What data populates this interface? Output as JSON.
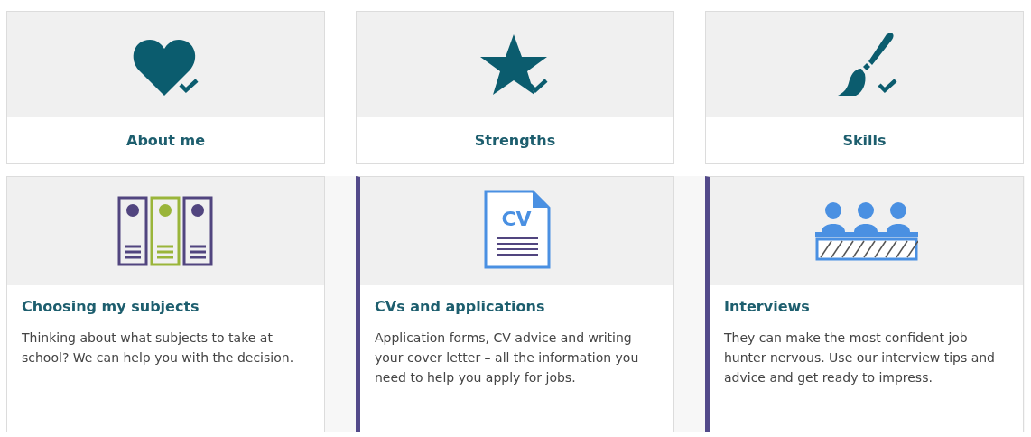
{
  "done_tiles": [
    {
      "kind": "heart",
      "label": "About me",
      "checked": true
    },
    {
      "kind": "star",
      "label": "Strengths",
      "checked": true
    },
    {
      "kind": "brush",
      "label": "Skills",
      "checked": true
    }
  ],
  "topic_cards": [
    {
      "kind": "binders",
      "title": "Choosing my subjects",
      "text": "Thinking about what subjects to take at school? We can help you with the decision.",
      "accent": false
    },
    {
      "kind": "cv",
      "icon_text": "CV",
      "title": "CVs and applications",
      "text": "Application forms, CV advice and writing your cover letter – all the information you need to help you apply for jobs.",
      "accent": true
    },
    {
      "kind": "panel",
      "title": "Interviews",
      "text": "They can make the most confident job hunter nervous. Use our interview tips and advice and get ready to impress.",
      "accent": true
    }
  ]
}
